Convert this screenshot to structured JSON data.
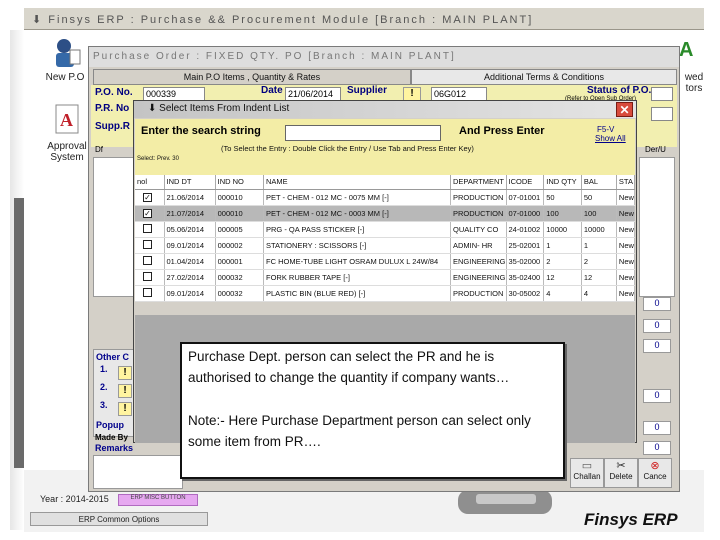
{
  "outer_window": {
    "title": "Finsys ERP : Purchase && Procurement Module   [Branch : MAIN PLANT]",
    "desktop_labels": [
      "New P.O",
      "Approval System",
      "wed tors"
    ],
    "year_label": "Year : 2014-2015",
    "common_options": "ERP Common Options",
    "misc_button": "ERP MISC BUTTON"
  },
  "po_window": {
    "title": "Purchase Order : FIXED QTY. PO   [Branch : MAIN PLANT]",
    "tabs": [
      "Main P.O Items , Quantity & Rates",
      "Additional Terms & Conditions"
    ],
    "fields": {
      "po_no_label": "P.O. No.",
      "po_no_value": "000339",
      "date_label": "Date",
      "date_value": "21/06/2014",
      "supplier_label": "Supplier",
      "supplier_code": "06G012",
      "pr_no_label": "P.R. No",
      "supp_label": "Supp.R",
      "status_label": "Status of P.O.",
      "status_hint": "(Refer to Open Sub Order)",
      "warn_symbol": "!"
    },
    "grid_col_label": "Df",
    "grid_right_col": "Der/U",
    "other_label": "Other C",
    "other_rows": [
      "1.",
      "2.",
      "3."
    ],
    "popup_label": "Popup",
    "made_by_label": "Made By",
    "remarks_label": "Remarks",
    "side_button_label": "0"
  },
  "dialog": {
    "title": "Select Items From Indent List",
    "close_symbol": "✕",
    "search_label": "Enter the search string",
    "search_value": "",
    "press_enter_label": "And Press Enter",
    "f5_hint": "F5-V",
    "show_all": "Show All",
    "hint": "(To Select the Entry : Double Click the Entry / Use Tab and Press Enter Key)",
    "select_info": "Select: Prev. 30",
    "columns": [
      "nol",
      "IND DT",
      "IND NO",
      "NAME",
      "DEPARTMENT",
      "ICODE",
      "IND QTY",
      "BAL",
      "STA"
    ],
    "rows": [
      {
        "checked": true,
        "ind_dt": "21.06/2014",
        "ind_no": "000010",
        "name": "PET - CHEM - 012 MC - 0075 MM [-]",
        "dept": "PRODUCTION",
        "icode": "07-01001",
        "qty": "50",
        "bal": "50",
        "sta": "New",
        "selected": false
      },
      {
        "checked": true,
        "ind_dt": "21.07/2014",
        "ind_no": "000010",
        "name": "PET - CHEM - 012 MC - 0003 MM [-]",
        "dept": "PRODUCTION",
        "icode": "07-01000",
        "qty": "100",
        "bal": "100",
        "sta": "New",
        "selected": true
      },
      {
        "checked": false,
        "ind_dt": "05.06/2014",
        "ind_no": "000005",
        "name": "PRG - QA PASS STICKER [-]",
        "dept": "QUALITY CO",
        "icode": "24-01002",
        "qty": "10000",
        "bal": "10000",
        "sta": "New",
        "selected": false
      },
      {
        "checked": false,
        "ind_dt": "09.01/2014",
        "ind_no": "000002",
        "name": "STATIONERY : SCISSORS [-]",
        "dept": "ADMIN- HR",
        "icode": "25-02001",
        "qty": "1",
        "bal": "1",
        "sta": "New",
        "selected": false
      },
      {
        "checked": false,
        "ind_dt": "01.04/2014",
        "ind_no": "000001",
        "name": "FC HOME-TUBE LIGHT OSRAM DULUX L 24W/84",
        "dept": "ENGINEERING",
        "icode": "35-02000",
        "qty": "2",
        "bal": "2",
        "sta": "New",
        "selected": false
      },
      {
        "checked": false,
        "ind_dt": "27.02/2014",
        "ind_no": "000032",
        "name": "FORK RUBBER TAPE [-]",
        "dept": "ENGINEERING",
        "icode": "35-02400",
        "qty": "12",
        "bal": "12",
        "sta": "New",
        "selected": false
      },
      {
        "checked": false,
        "ind_dt": "09.01/2014",
        "ind_no": "000032",
        "name": "PLASTIC BIN (BLUE RED) [-]",
        "dept": "PRODUCTION",
        "icode": "30-05002",
        "qty": "4",
        "bal": "4",
        "sta": "New",
        "selected": false
      }
    ]
  },
  "note": {
    "line1": "Purchase Dept. person can select the PR and he is authorised to change the quantity if company wants…",
    "line2": "Note:- Here Purchase Department person can select only some item from PR…."
  },
  "toolbar": {
    "challan": "Challan",
    "delete": "Delete",
    "cancel": "Cance"
  },
  "brand": "Finsys ERP",
  "colors": {
    "header_yellow": "#f2efb0",
    "dialog_gray": "#d4d0c8",
    "close_red": "#d84b3c",
    "label_blue": "#000080"
  }
}
